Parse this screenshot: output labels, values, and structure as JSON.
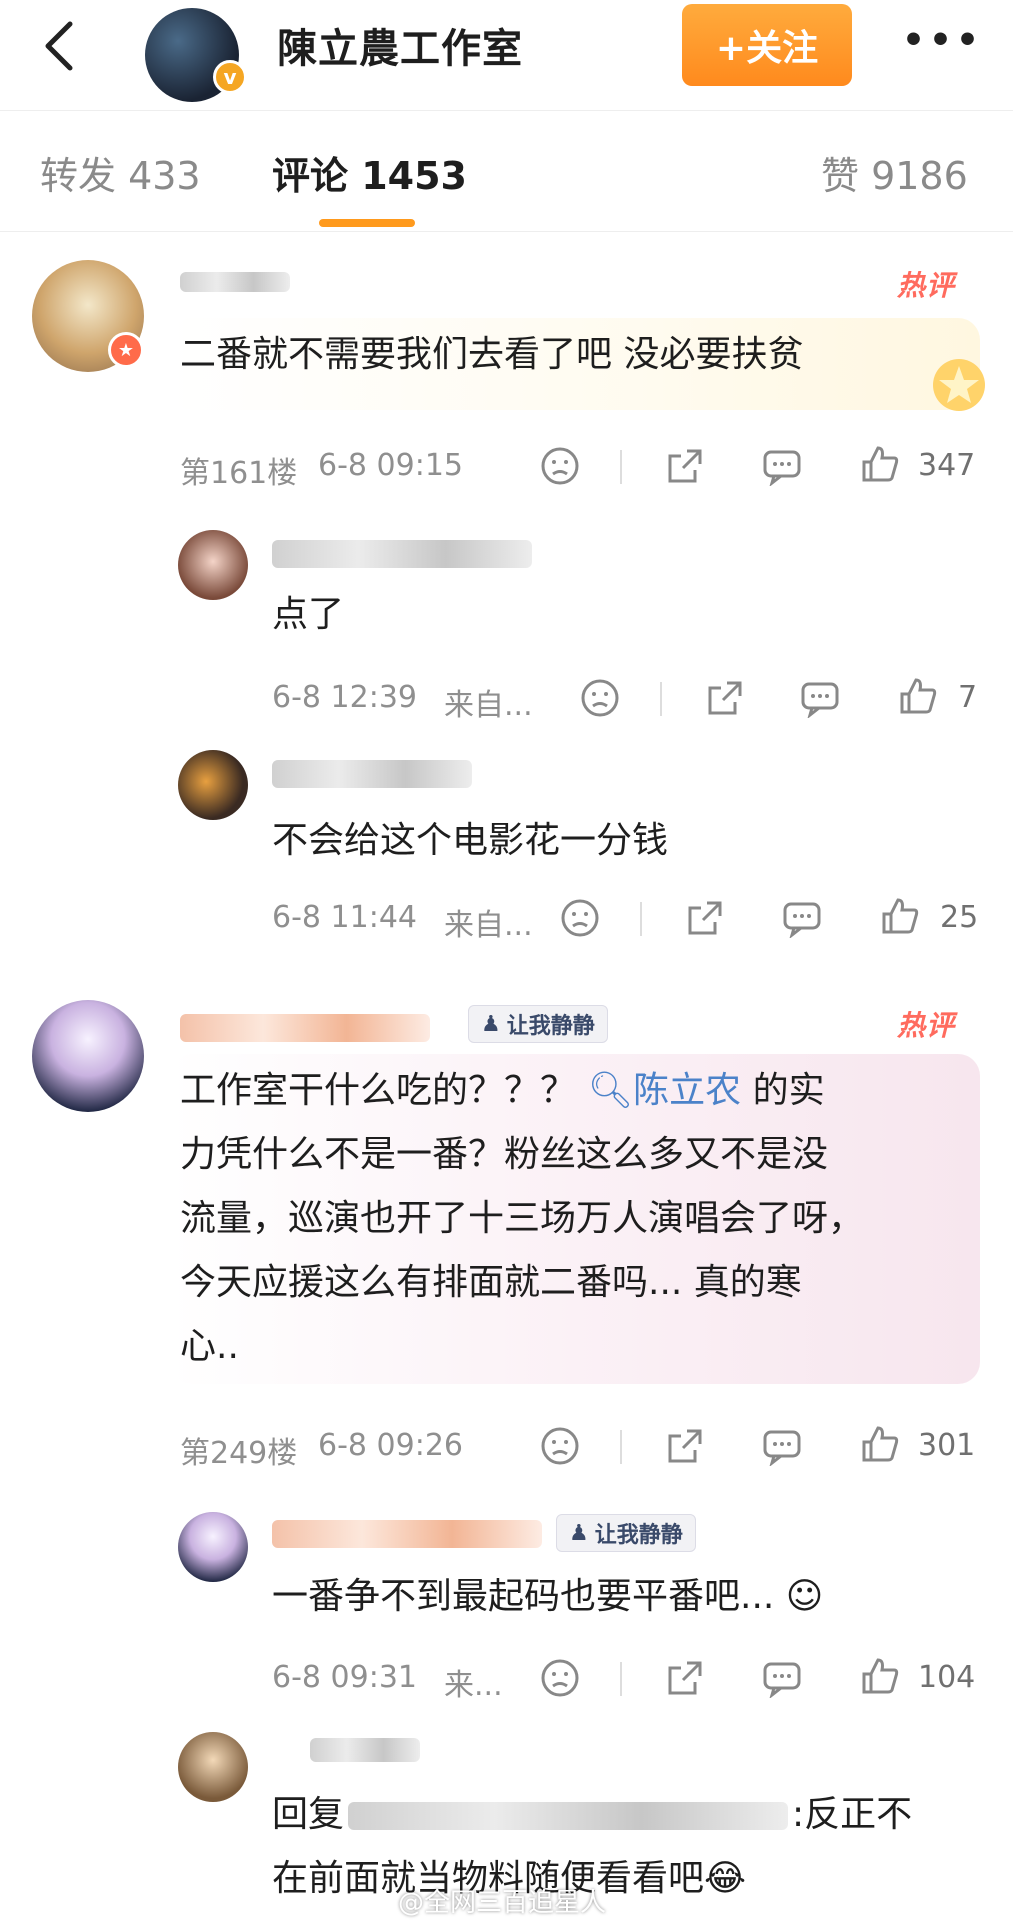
{
  "header": {
    "title": "陳立農工作室",
    "follow_label": "+关注",
    "more_label": "•••",
    "verified_mark": "v"
  },
  "tabs": [
    {
      "label": "转发 433"
    },
    {
      "label": "评论 1453"
    },
    {
      "label": "赞 9186"
    }
  ],
  "comments": [
    {
      "hot_label": "热评",
      "text": "二番就不需要我们去看了吧 没必要扶贫",
      "floor": "第161楼",
      "time": "6-8 09:15",
      "likes": "347",
      "replies": [
        {
          "text": "点了",
          "time": "6-8 12:39",
          "source": "来自...",
          "likes": "7"
        },
        {
          "text": "不会给这个电影花一分钱",
          "time": "6-8 11:44",
          "source": "来自...",
          "likes": "25"
        }
      ]
    },
    {
      "hot_label": "热评",
      "badge": "让我静静",
      "text_before": "工作室干什么吃的？？？",
      "mention": "陈立农",
      "text_line1_after": "的实",
      "text_lines": [
        "力凭什么不是一番？粉丝这么多又不是没",
        "流量，巡演也开了十三场万人演唱会了呀，",
        "今天应援这么有排面就二番吗... 真的寒",
        "心.."
      ],
      "floor": "第249楼",
      "time": "6-8 09:26",
      "likes": "301",
      "replies": [
        {
          "badge": "让我静静",
          "text": "一番争不到最起码也要平番吧...",
          "time": "6-8 09:31",
          "source": "来...",
          "likes": "104"
        },
        {
          "text_prefix": "回复",
          "text_suffix": ":反正不",
          "text_line2": "在前面就当物料随便看看吧"
        }
      ]
    }
  ],
  "watermark": "@全网三百追星人",
  "colors": {
    "accent": "#ff9a1d",
    "hot": "#ff6b5e",
    "mention": "#4b82c9",
    "meta": "#8f8f8f"
  }
}
